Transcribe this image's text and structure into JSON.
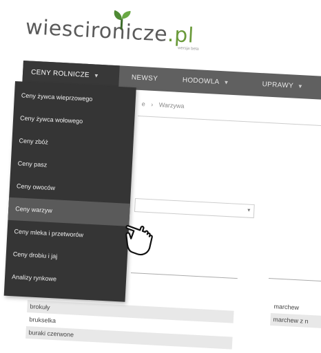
{
  "logo": {
    "part1": "wiesciro",
    "part2": "nicze",
    "part3": ".pl",
    "tagline": "wersja beta"
  },
  "nav": {
    "items": [
      {
        "label": "CENY ROLNICZE",
        "caret": "▼",
        "active": true
      },
      {
        "label": "NEWSY",
        "caret": "",
        "active": false
      },
      {
        "label": "HODOWLA",
        "caret": "▼",
        "active": false
      },
      {
        "label": "UPRAWY",
        "caret": "▼",
        "active": false
      }
    ]
  },
  "breadcrumb": {
    "part1": "e",
    "sep": "›",
    "part2": "Warzywa"
  },
  "dropdown": {
    "items": [
      "Ceny żywca wieprzowego",
      "Ceny żywca wołowego",
      "Ceny zbóż",
      "Ceny pasz",
      "Ceny owoców",
      "Ceny warzyw",
      "Ceny mleka i przetworów",
      "Ceny drobiu i jaj",
      "Analizy rynkowe"
    ],
    "hover_index": 5
  },
  "select": {
    "arrow": "▾"
  },
  "vegetables_left": [
    "brokuły",
    "brukselka",
    "buraki czerwone"
  ],
  "vegetables_right": [
    "marchew",
    "marchew z n"
  ],
  "colors": {
    "nav_bg": "#606060",
    "dropdown_bg": "#353535",
    "hover_bg": "#5a5a5a",
    "brand_green": "#6a9a3a"
  }
}
